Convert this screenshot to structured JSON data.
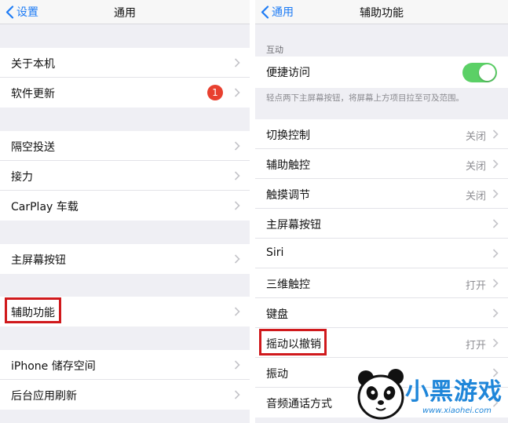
{
  "left": {
    "back_label": "设置",
    "title": "通用",
    "groups": [
      [
        "关于本机",
        "软件更新"
      ],
      [
        "隔空投送",
        "接力",
        "CarPlay 车载"
      ],
      [
        "主屏幕按钮"
      ],
      [
        "辅助功能"
      ],
      [
        "iPhone 储存空间",
        "后台应用刷新"
      ]
    ],
    "update_badge": "1"
  },
  "right": {
    "back_label": "通用",
    "title": "辅助功能",
    "section_header": "互动",
    "reachability_label": "便捷访问",
    "reachability_on": true,
    "reachability_footer": "轻点两下主屏幕按钮，将屏幕上方项目拉至可及范围。",
    "rows": [
      {
        "label": "切换控制",
        "value": "关闭"
      },
      {
        "label": "辅助触控",
        "value": "关闭"
      },
      {
        "label": "触摸调节",
        "value": "关闭"
      },
      {
        "label": "主屏幕按钮",
        "value": ""
      },
      {
        "label": "Siri",
        "value": ""
      },
      {
        "label": "三维触控",
        "value": "打开"
      },
      {
        "label": "键盘",
        "value": ""
      },
      {
        "label": "摇动以撤销",
        "value": "打开"
      },
      {
        "label": "振动",
        "value": ""
      },
      {
        "label": "音频通话方式",
        "value": ""
      }
    ]
  },
  "watermark": {
    "brand": "小黑游戏",
    "url": "www.xiaohei.com"
  },
  "colors": {
    "accent": "#1e7cf5",
    "toggle_on": "#5bd066",
    "badge": "#e8402f",
    "highlight": "#d0191c"
  }
}
